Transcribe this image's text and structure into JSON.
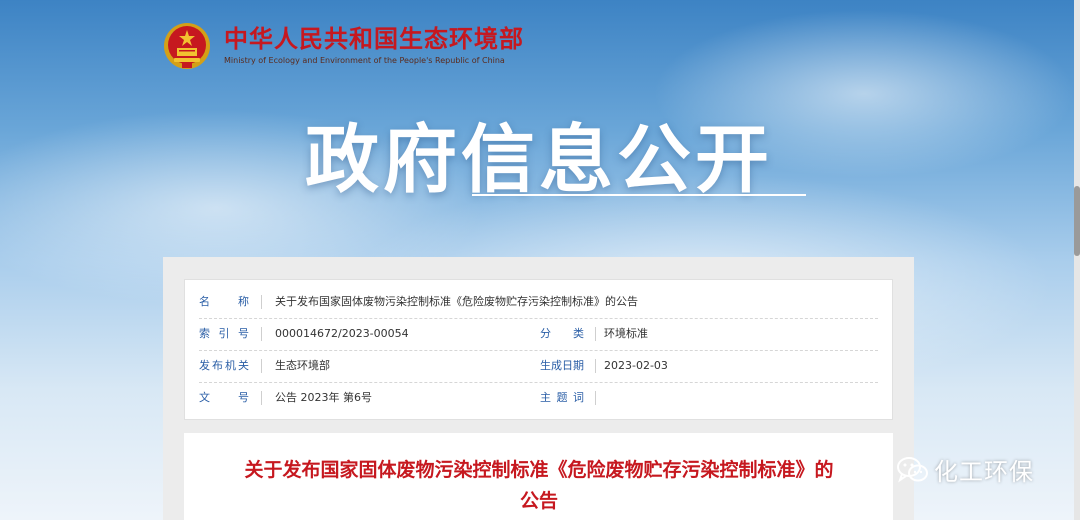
{
  "header": {
    "org_name_cn": "中华人民共和国生态环境部",
    "org_name_en": "Ministry of Ecology and Environment of the People's Republic of China"
  },
  "hero": {
    "title": "政府信息公开"
  },
  "meta": {
    "name_label": "名　称",
    "name_value": "关于发布国家固体废物污染控制标准《危险废物贮存污染控制标准》的公告",
    "index_label": "索 引 号",
    "index_value": "000014672/2023-00054",
    "category_label": "分　类",
    "category_value": "环境标准",
    "issuer_label": "发布机关",
    "issuer_value": "生态环境部",
    "date_label": "生成日期",
    "date_value": "2023-02-03",
    "doc_no_label": "文　号",
    "doc_no_value": "公告 2023年 第6号",
    "keywords_label": "主 题 词",
    "keywords_value": ""
  },
  "article": {
    "title": "关于发布国家固体废物污染控制标准《危险废物贮存污染控制标准》的公告"
  },
  "watermark": {
    "text": "化工环保",
    "icon": "wechat-icon"
  },
  "colors": {
    "brand_red": "#c6181f",
    "label_blue": "#2a5ea6"
  }
}
